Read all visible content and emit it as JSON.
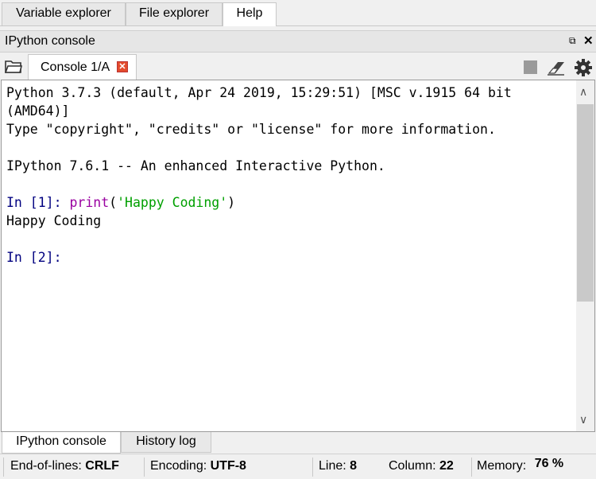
{
  "top_tabs": [
    {
      "label": "Variable explorer",
      "active": false
    },
    {
      "label": "File explorer",
      "active": false
    },
    {
      "label": "Help",
      "active": true
    }
  ],
  "pane": {
    "title": "IPython console",
    "undock_icon": "undock-icon",
    "close_icon": "close-icon"
  },
  "console_toolbar": {
    "browse_icon": "folder-icon",
    "tab_label": "Console 1/A",
    "tab_close_icon": "close-tab-icon",
    "stop_icon": "stop-icon",
    "clear_icon": "eraser-icon",
    "options_icon": "gear-icon"
  },
  "console": {
    "banner_line1": "Python 3.7.3 (default, Apr 24 2019, 15:29:51) [MSC v.1915 64 bit",
    "banner_line2": "(AMD64)]",
    "banner_line3": "Type \"copyright\", \"credits\" or \"license\" for more information.",
    "banner_line4": "IPython 7.6.1 -- An enhanced Interactive Python.",
    "prompt1": "In [1]:",
    "input1_func": "print",
    "input1_open": "(",
    "input1_string": "'Happy Coding'",
    "input1_close": ")",
    "output1": "Happy Coding",
    "prompt2": "In [2]:"
  },
  "bottom_tabs": [
    {
      "label": "IPython console",
      "active": true
    },
    {
      "label": "History log",
      "active": false
    }
  ],
  "status_bar": {
    "eol_label": "End-of-lines:",
    "eol_value": "CRLF",
    "encoding_label": "Encoding:",
    "encoding_value": "UTF-8",
    "line_label": "Line:",
    "line_value": "8",
    "column_label": "Column:",
    "column_value": "22",
    "memory_label": "Memory:",
    "memory_value": "76 %"
  },
  "colors": {
    "prompt": "#000080",
    "builtin": "#9900a0",
    "string": "#00a000",
    "tab_close": "#e34b2c"
  }
}
